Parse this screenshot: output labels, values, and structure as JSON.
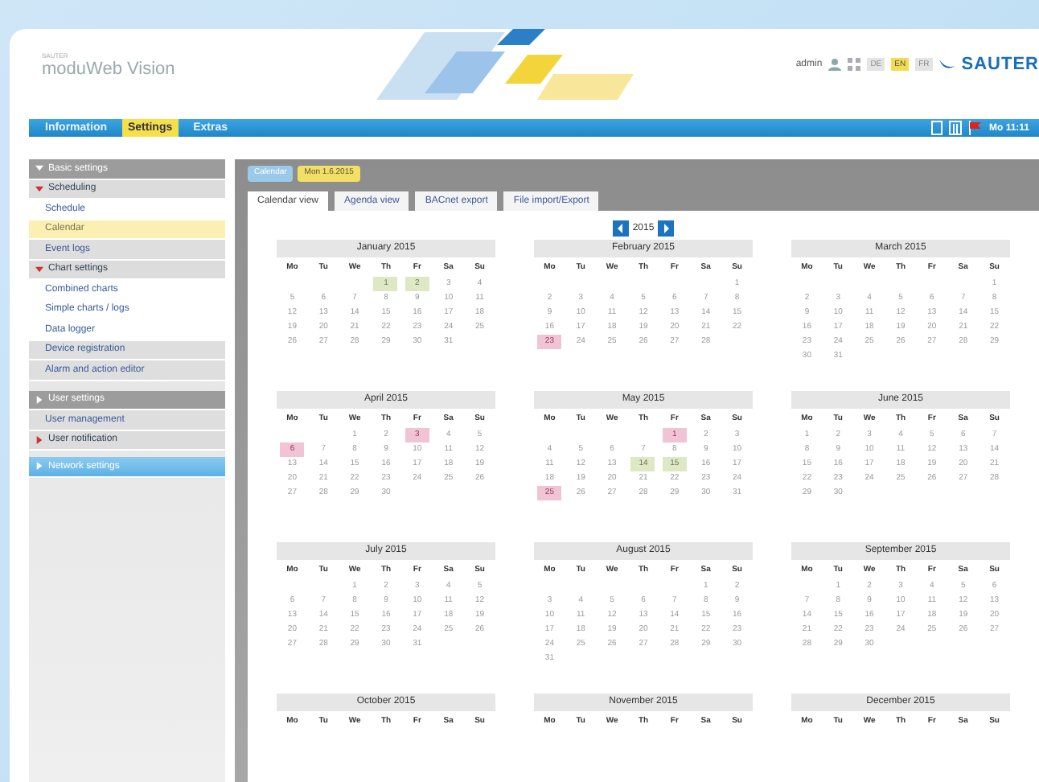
{
  "header": {
    "brand_small": "SAUTER",
    "brand": "moduWeb Vision",
    "user": "admin",
    "languages": [
      {
        "label": "DE",
        "selected": false
      },
      {
        "label": "EN",
        "selected": true
      },
      {
        "label": "FR",
        "selected": false
      }
    ],
    "logo": "SAUTER"
  },
  "nav": {
    "items": [
      {
        "label": "Information",
        "selected": false
      },
      {
        "label": "Settings",
        "selected": true
      },
      {
        "label": "Extras",
        "selected": false
      }
    ],
    "clock": "Mo 11:11"
  },
  "sidebar": {
    "items": [
      {
        "kind": "group",
        "label": "Basic settings",
        "expanded": true
      },
      {
        "kind": "section",
        "label": "Scheduling",
        "expanded": true
      },
      {
        "kind": "link",
        "label": "Schedule",
        "selected": false
      },
      {
        "kind": "link",
        "label": "Calendar",
        "selected": true
      },
      {
        "kind": "plain",
        "label": "Event logs"
      },
      {
        "kind": "section",
        "label": "Chart settings",
        "expanded": true
      },
      {
        "kind": "link",
        "label": "Combined charts",
        "selected": false
      },
      {
        "kind": "link",
        "label": "Simple charts / logs",
        "selected": false
      },
      {
        "kind": "link",
        "label": "Data logger",
        "selected": false
      },
      {
        "kind": "plain",
        "label": "Device registration"
      },
      {
        "kind": "plain",
        "label": "Alarm and action editor"
      },
      {
        "kind": "group",
        "label": "User settings",
        "expanded": false
      },
      {
        "kind": "plain",
        "label": "User management"
      },
      {
        "kind": "section",
        "label": "User notification",
        "expanded": false
      },
      {
        "kind": "button",
        "label": "Network settings"
      }
    ]
  },
  "breadcrumb": [
    {
      "label": "Calendar",
      "kind": "page"
    },
    {
      "label": "Mon 1.6.2015",
      "kind": "date"
    }
  ],
  "tabs": [
    {
      "label": "Calendar view",
      "selected": true
    },
    {
      "label": "Agenda view",
      "selected": false
    },
    {
      "label": "BACnet export",
      "selected": false
    },
    {
      "label": "File import/Export",
      "selected": false
    }
  ],
  "year": "2015",
  "months": [
    {
      "title": "January 2015",
      "weekdays": [
        "Mo",
        "Tu",
        "We",
        "Th",
        "Fr",
        "Sa",
        "Su"
      ],
      "weeks": [
        [
          {
            "day": "1",
            "kind": "bridge"
          },
          {
            "day": "2",
            "kind": "bridge"
          },
          "3",
          "4"
        ],
        [
          "5",
          "6",
          "7",
          "8",
          "9",
          "10",
          "11"
        ],
        [
          "12",
          "13",
          "14",
          "15",
          "16",
          "17",
          "18"
        ],
        [
          "19",
          "20",
          "21",
          "22",
          "23",
          "24",
          "25"
        ],
        [
          "26",
          "27",
          "28",
          "29",
          "30",
          "31"
        ]
      ]
    },
    {
      "title": "February 2015",
      "weekdays": [
        "Mo",
        "Tu",
        "We",
        "Th",
        "Fr",
        "Sa",
        "Su"
      ],
      "weeks": [
        [
          "1"
        ],
        [
          "2",
          "3",
          "4",
          "5",
          "6",
          "7",
          "8"
        ],
        [
          "9",
          "10",
          "11",
          "12",
          "13",
          "14",
          "15"
        ],
        [
          "16",
          "17",
          "18",
          "19",
          "20",
          "21",
          "22"
        ],
        [
          {
            "day": "23",
            "kind": "holiday"
          },
          "24",
          "25",
          "26",
          "27",
          "28"
        ]
      ]
    },
    {
      "title": "March 2015",
      "weekdays": [
        "Mo",
        "Tu",
        "We",
        "Th",
        "Fr",
        "Sa",
        "Su"
      ],
      "weeks": [
        [
          "1"
        ],
        [
          "2",
          "3",
          "4",
          "5",
          "6",
          "7",
          "8"
        ],
        [
          "9",
          "10",
          "11",
          "12",
          "13",
          "14",
          "15"
        ],
        [
          "16",
          "17",
          "18",
          "19",
          "20",
          "21",
          "22"
        ],
        [
          "23",
          "24",
          "25",
          "26",
          "27",
          "28",
          "29"
        ],
        [
          "30",
          "31"
        ]
      ]
    },
    {
      "title": "April 2015",
      "weekdays": [
        "Mo",
        "Tu",
        "We",
        "Th",
        "Fr",
        "Sa",
        "Su"
      ],
      "weeks": [
        [
          "1",
          "2",
          {
            "day": "3",
            "kind": "holiday"
          },
          "4",
          "5"
        ],
        [
          {
            "day": "6",
            "kind": "holiday"
          },
          "7",
          "8",
          "9",
          "10",
          "11",
          "12"
        ],
        [
          "13",
          "14",
          "15",
          "16",
          "17",
          "18",
          "19"
        ],
        [
          "20",
          "21",
          "22",
          "23",
          "24",
          "25",
          "26"
        ],
        [
          "27",
          "28",
          "29",
          "30"
        ]
      ]
    },
    {
      "title": "May 2015",
      "weekdays": [
        "Mo",
        "Tu",
        "We",
        "Th",
        "Fr",
        "Sa",
        "Su"
      ],
      "weeks": [
        [
          {
            "day": "1",
            "kind": "holiday"
          },
          "2",
          "3"
        ],
        [
          "4",
          "5",
          "6",
          "7",
          "8",
          "9",
          "10"
        ],
        [
          "11",
          "12",
          "13",
          {
            "day": "14",
            "kind": "bridge"
          },
          {
            "day": "15",
            "kind": "bridge"
          },
          "16",
          "17"
        ],
        [
          "18",
          "19",
          "20",
          "21",
          "22",
          "23",
          "24"
        ],
        [
          {
            "day": "25",
            "kind": "holiday"
          },
          "26",
          "27",
          "28",
          "29",
          "30",
          "31"
        ]
      ]
    },
    {
      "title": "June 2015",
      "weekdays": [
        "Mo",
        "Tu",
        "We",
        "Th",
        "Fr",
        "Sa",
        "Su"
      ],
      "weeks": [
        [
          "1",
          "2",
          "3",
          "4",
          "5",
          "6",
          "7"
        ],
        [
          "8",
          "9",
          "10",
          "11",
          "12",
          "13",
          "14"
        ],
        [
          "15",
          "16",
          "17",
          "18",
          "19",
          "20",
          "21"
        ],
        [
          "22",
          "23",
          "24",
          "25",
          "26",
          "27",
          "28"
        ],
        [
          "29",
          "30"
        ]
      ]
    },
    {
      "title": "July 2015",
      "weekdays": [
        "Mo",
        "Tu",
        "We",
        "Th",
        "Fr",
        "Sa",
        "Su"
      ],
      "weeks": [
        [
          "1",
          "2",
          "3",
          "4",
          "5"
        ],
        [
          "6",
          "7",
          "8",
          "9",
          "10",
          "11",
          "12"
        ],
        [
          "13",
          "14",
          "15",
          "16",
          "17",
          "18",
          "19"
        ],
        [
          "20",
          "21",
          "22",
          "23",
          "24",
          "25",
          "26"
        ],
        [
          "27",
          "28",
          "29",
          "30",
          "31"
        ]
      ]
    },
    {
      "title": "August 2015",
      "weekdays": [
        "Mo",
        "Tu",
        "We",
        "Th",
        "Fr",
        "Sa",
        "Su"
      ],
      "weeks": [
        [
          "1",
          "2"
        ],
        [
          "3",
          "4",
          "5",
          "6",
          "7",
          "8",
          "9"
        ],
        [
          "10",
          "11",
          "12",
          "13",
          "14",
          "15",
          "16"
        ],
        [
          "17",
          "18",
          "19",
          "20",
          "21",
          "22",
          "23"
        ],
        [
          "24",
          "25",
          "26",
          "27",
          "28",
          "29",
          "30"
        ],
        [
          "31"
        ]
      ]
    },
    {
      "title": "September 2015",
      "weekdays": [
        "Mo",
        "Tu",
        "We",
        "Th",
        "Fr",
        "Sa",
        "Su"
      ],
      "weeks": [
        [
          "1",
          "2",
          "3",
          "4",
          "5",
          "6"
        ],
        [
          "7",
          "8",
          "9",
          "10",
          "11",
          "12",
          "13"
        ],
        [
          "14",
          "15",
          "16",
          "17",
          "18",
          "19",
          "20"
        ],
        [
          "21",
          "22",
          "23",
          "24",
          "25",
          "26",
          "27"
        ],
        [
          "28",
          "29",
          "30"
        ]
      ]
    },
    {
      "title": "October 2015",
      "weekdays": [
        "Mo",
        "Tu",
        "We",
        "Th",
        "Fr",
        "Sa",
        "Su"
      ]
    },
    {
      "title": "November 2015",
      "weekdays": [
        "Mo",
        "Tu",
        "We",
        "Th",
        "Fr",
        "Sa",
        "Su"
      ]
    },
    {
      "title": "December 2015",
      "weekdays": [
        "Mo",
        "Tu",
        "We",
        "Th",
        "Fr",
        "Sa",
        "Su"
      ]
    }
  ]
}
